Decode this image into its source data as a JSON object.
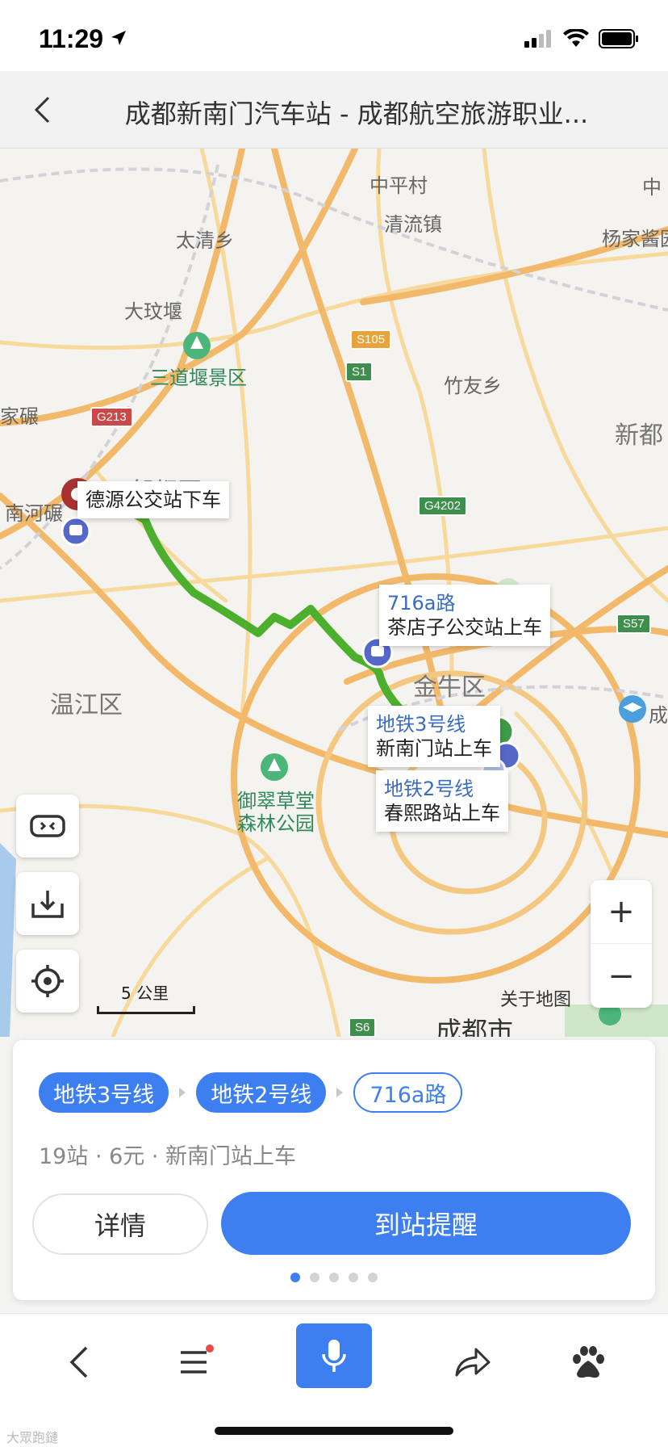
{
  "status_bar": {
    "time": "11:29"
  },
  "header": {
    "title": "成都新南门汽车站 - 成都航空旅游职业..."
  },
  "map": {
    "place_labels": [
      {
        "id": "zhongpingcun",
        "text": "中平村"
      },
      {
        "id": "qingliuzhen",
        "text": "清流镇"
      },
      {
        "id": "taiqingxiang",
        "text": "太清乡"
      },
      {
        "id": "yangjiaqiao",
        "text": "杨家酱园"
      },
      {
        "id": "dawenyan",
        "text": "大玟堰"
      },
      {
        "id": "sandaoyan",
        "text": "三道堰景区"
      },
      {
        "id": "zhuyouxiang",
        "text": "竹友乡"
      },
      {
        "id": "jianian",
        "text": "家碾"
      },
      {
        "id": "xindu",
        "text": "新都"
      },
      {
        "id": "pixian",
        "text": "郫都区"
      },
      {
        "id": "nanhenian",
        "text": "南河碾"
      },
      {
        "id": "wenjiang",
        "text": "温江区"
      },
      {
        "id": "jinniu",
        "text": "金牛区"
      },
      {
        "id": "yucui",
        "text": "御翠草堂"
      },
      {
        "id": "senlin",
        "text": "森林公园"
      },
      {
        "id": "zhong",
        "text": "中"
      },
      {
        "id": "cheng",
        "text": "成"
      }
    ],
    "road_badges": {
      "s105": "S105",
      "s1": "S1",
      "g213": "G213",
      "g4202": "G4202",
      "s57": "S57",
      "s6": "S6"
    },
    "callouts": {
      "alight": {
        "text": "德源公交站下车"
      },
      "bus716": {
        "line": "716a路",
        "stop": "茶店子公交站上车"
      },
      "metro3": {
        "line": "地铁3号线",
        "stop": "新南门站上车"
      },
      "metro2": {
        "line": "地铁2号线",
        "stop": "春熙路站上车"
      }
    },
    "scale": "5 公里",
    "about": "关于地图",
    "city": "成都市",
    "zoom_in": "+",
    "zoom_out": "−"
  },
  "route_card": {
    "chips": [
      "地铁3号线",
      "地铁2号线",
      "716a路"
    ],
    "meta": "19站 · 6元 · 新南门站上车",
    "detail_button": "详情",
    "remind_button": "到站提醒",
    "page_count": 5,
    "page_active": 1
  },
  "bottom_bar": {
    "watermark": "大眾跑鏈"
  },
  "colors": {
    "accent": "#3d7ff0",
    "route": "#4caf2e",
    "road_major": "#f2b96a",
    "road_minor": "#f7d99c"
  }
}
